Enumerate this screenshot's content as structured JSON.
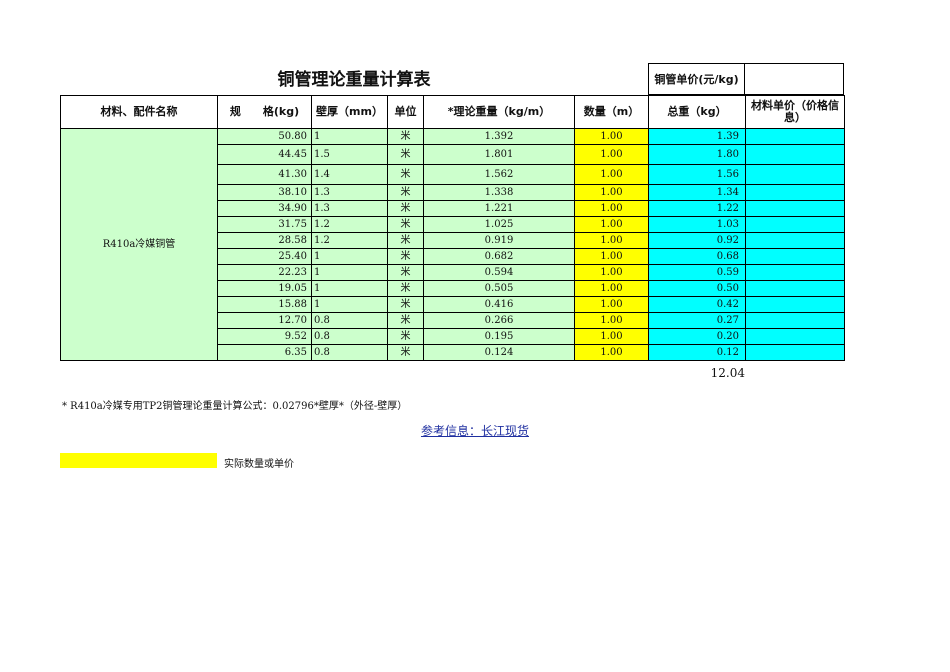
{
  "sheet": {
    "title": "铜管理论重量计算表",
    "unit_price_label": "铜管单价(元/kg)",
    "headers": {
      "material": "材料、配件名称",
      "spec": "规　　格(kg)",
      "thickness": "壁厚（mm）",
      "unit": "单位",
      "theory": "*理论重量（kg/m）",
      "qty": "数量（m）",
      "total": "总重（kg）",
      "price": "材料单价（价格信息）"
    },
    "material_name": "R410a冷媒铜管",
    "rows": [
      {
        "spec": "50.80",
        "thickness": "1",
        "unit": "米",
        "theory": "1.392",
        "qty": "1.00",
        "total": "1.39"
      },
      {
        "spec": "44.45",
        "thickness": "1.5",
        "unit": "米",
        "theory": "1.801",
        "qty": "1.00",
        "total": "1.80"
      },
      {
        "spec": "41.30",
        "thickness": "1.4",
        "unit": "米",
        "theory": "1.562",
        "qty": "1.00",
        "total": "1.56"
      },
      {
        "spec": "38.10",
        "thickness": "1.3",
        "unit": "米",
        "theory": "1.338",
        "qty": "1.00",
        "total": "1.34"
      },
      {
        "spec": "34.90",
        "thickness": "1.3",
        "unit": "米",
        "theory": "1.221",
        "qty": "1.00",
        "total": "1.22"
      },
      {
        "spec": "31.75",
        "thickness": "1.2",
        "unit": "米",
        "theory": "1.025",
        "qty": "1.00",
        "total": "1.03"
      },
      {
        "spec": "28.58",
        "thickness": "1.2",
        "unit": "米",
        "theory": "0.919",
        "qty": "1.00",
        "total": "0.92"
      },
      {
        "spec": "25.40",
        "thickness": "1",
        "unit": "米",
        "theory": "0.682",
        "qty": "1.00",
        "total": "0.68"
      },
      {
        "spec": "22.23",
        "thickness": "1",
        "unit": "米",
        "theory": "0.594",
        "qty": "1.00",
        "total": "0.59"
      },
      {
        "spec": "19.05",
        "thickness": "1",
        "unit": "米",
        "theory": "0.505",
        "qty": "1.00",
        "total": "0.50"
      },
      {
        "spec": "15.88",
        "thickness": "1",
        "unit": "米",
        "theory": "0.416",
        "qty": "1.00",
        "total": "0.42"
      },
      {
        "spec": "12.70",
        "thickness": "0.8",
        "unit": "米",
        "theory": "0.266",
        "qty": "1.00",
        "total": "0.27"
      },
      {
        "spec": "9.52",
        "thickness": "0.8",
        "unit": "米",
        "theory": "0.195",
        "qty": "1.00",
        "total": "0.20"
      },
      {
        "spec": "6.35",
        "thickness": "0.8",
        "unit": "米",
        "theory": "0.124",
        "qty": "1.00",
        "total": "0.12"
      }
    ],
    "sum_total": "12.04",
    "note": "* R410a冷媒专用TP2铜管理论重量计算公式：0.02796*壁厚*（外径-壁厚）",
    "reference_link": "参考信息：长江现货",
    "legend_text": "实际数量或单价",
    "colors": {
      "green": "#ccffcc",
      "yellow": "#ffff00",
      "cyan": "#00ffff"
    }
  }
}
